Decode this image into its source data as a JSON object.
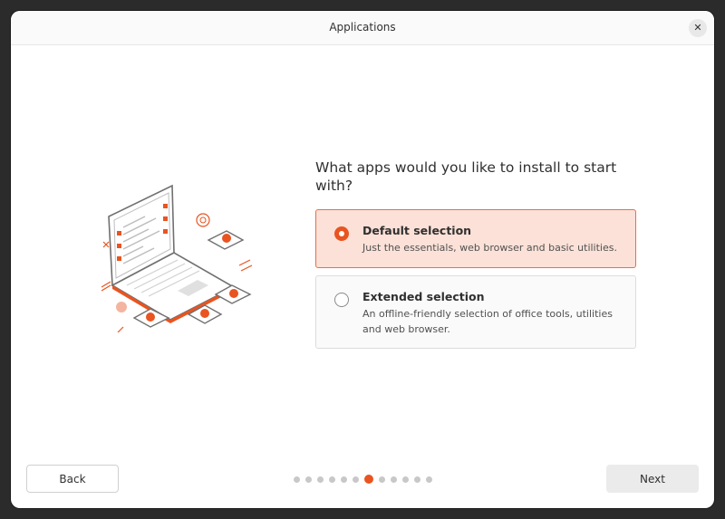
{
  "window": {
    "title": "Applications",
    "close_label": "✕"
  },
  "main": {
    "question": "What apps would you like to install to start with?"
  },
  "options": [
    {
      "title": "Default selection",
      "description": "Just the essentials, web browser and basic utilities.",
      "selected": true
    },
    {
      "title": "Extended selection",
      "description": "An offline-friendly selection of office tools, utilities and web browser.",
      "selected": false
    }
  ],
  "footer": {
    "back_label": "Back",
    "next_label": "Next",
    "steps_total": 12,
    "current_step": 7
  },
  "colors": {
    "accent": "#e95420",
    "selected_bg": "#fbe1d8"
  },
  "icons": [
    "close-icon",
    "laptop-illustration",
    "radio-selected-icon",
    "radio-unselected-icon"
  ]
}
